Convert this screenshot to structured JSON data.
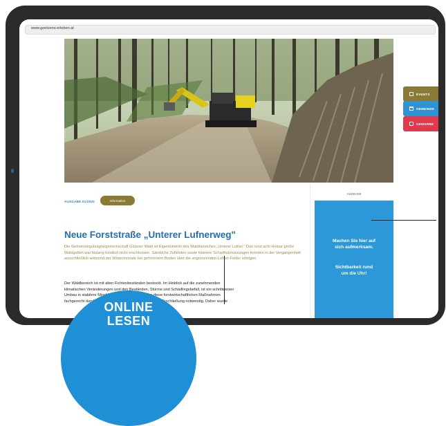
{
  "browser": {
    "url": "www.goetzens-erleben.at"
  },
  "side_tabs": [
    {
      "label": "EVENTS",
      "icon": "calendar-icon",
      "color": "#8a7a35"
    },
    {
      "label": "GEMEINDE",
      "icon": "building-icon",
      "color": "#2f93d3"
    },
    {
      "label": "GEWERBE",
      "icon": "shop-icon",
      "color": "#e03a4d"
    }
  ],
  "article": {
    "issue": "AUSGABE 01/2020",
    "category": "Information",
    "title": "Neue Forststraße „Unterer Lufnerweg\"",
    "lead": "Die Gemeindegutsagrargemeinschaft Götzner Wald ist Eigentümerin des Waldbereiches „Unterer Lufner.\" Das rund acht Hektar große Waldgebiet war bislang forstlich nicht erschlossen. Sämtliche Zufahrten sowie kleinere Schadholznutzungen konnten in der Vergangenheit ausschließlich während der Wintermonate bei gefrorenem Boden über die angrenzenden Lufner-Felder erfolgen.",
    "body_lines": [
      "Der Waldbereich ist mit alten Fichtenbeständen bestockt. Im Hinblick auf die zunehmenden",
      "klimatischen Veränderungen und den Beständen, Stürme und Schädlingsbefall, ist ein schrittweiser",
      "Umbau in stabilere Mischbestände erforderlich. Um diese forstwirtschaftlichen Maßnahmen",
      "fachgerecht durchführen zu können, ist eine zeitgemäße Erschließung notwendig. Daher wurde"
    ]
  },
  "ad": {
    "label": "ANZEIGE",
    "line1": "Machen Sie hier auf",
    "line2": "sich aufmerksam.",
    "line3": "Sichtbarkeit rund",
    "line4": "um die Uhr!",
    "color": "#2c98d8"
  },
  "badge": {
    "line1": "ONLINE",
    "line2": "LESEN",
    "color": "#1f8fd6"
  },
  "colors": {
    "title": "#1f6fb5",
    "lead": "#9a8c4a",
    "accent_olive": "#8a7a35"
  }
}
